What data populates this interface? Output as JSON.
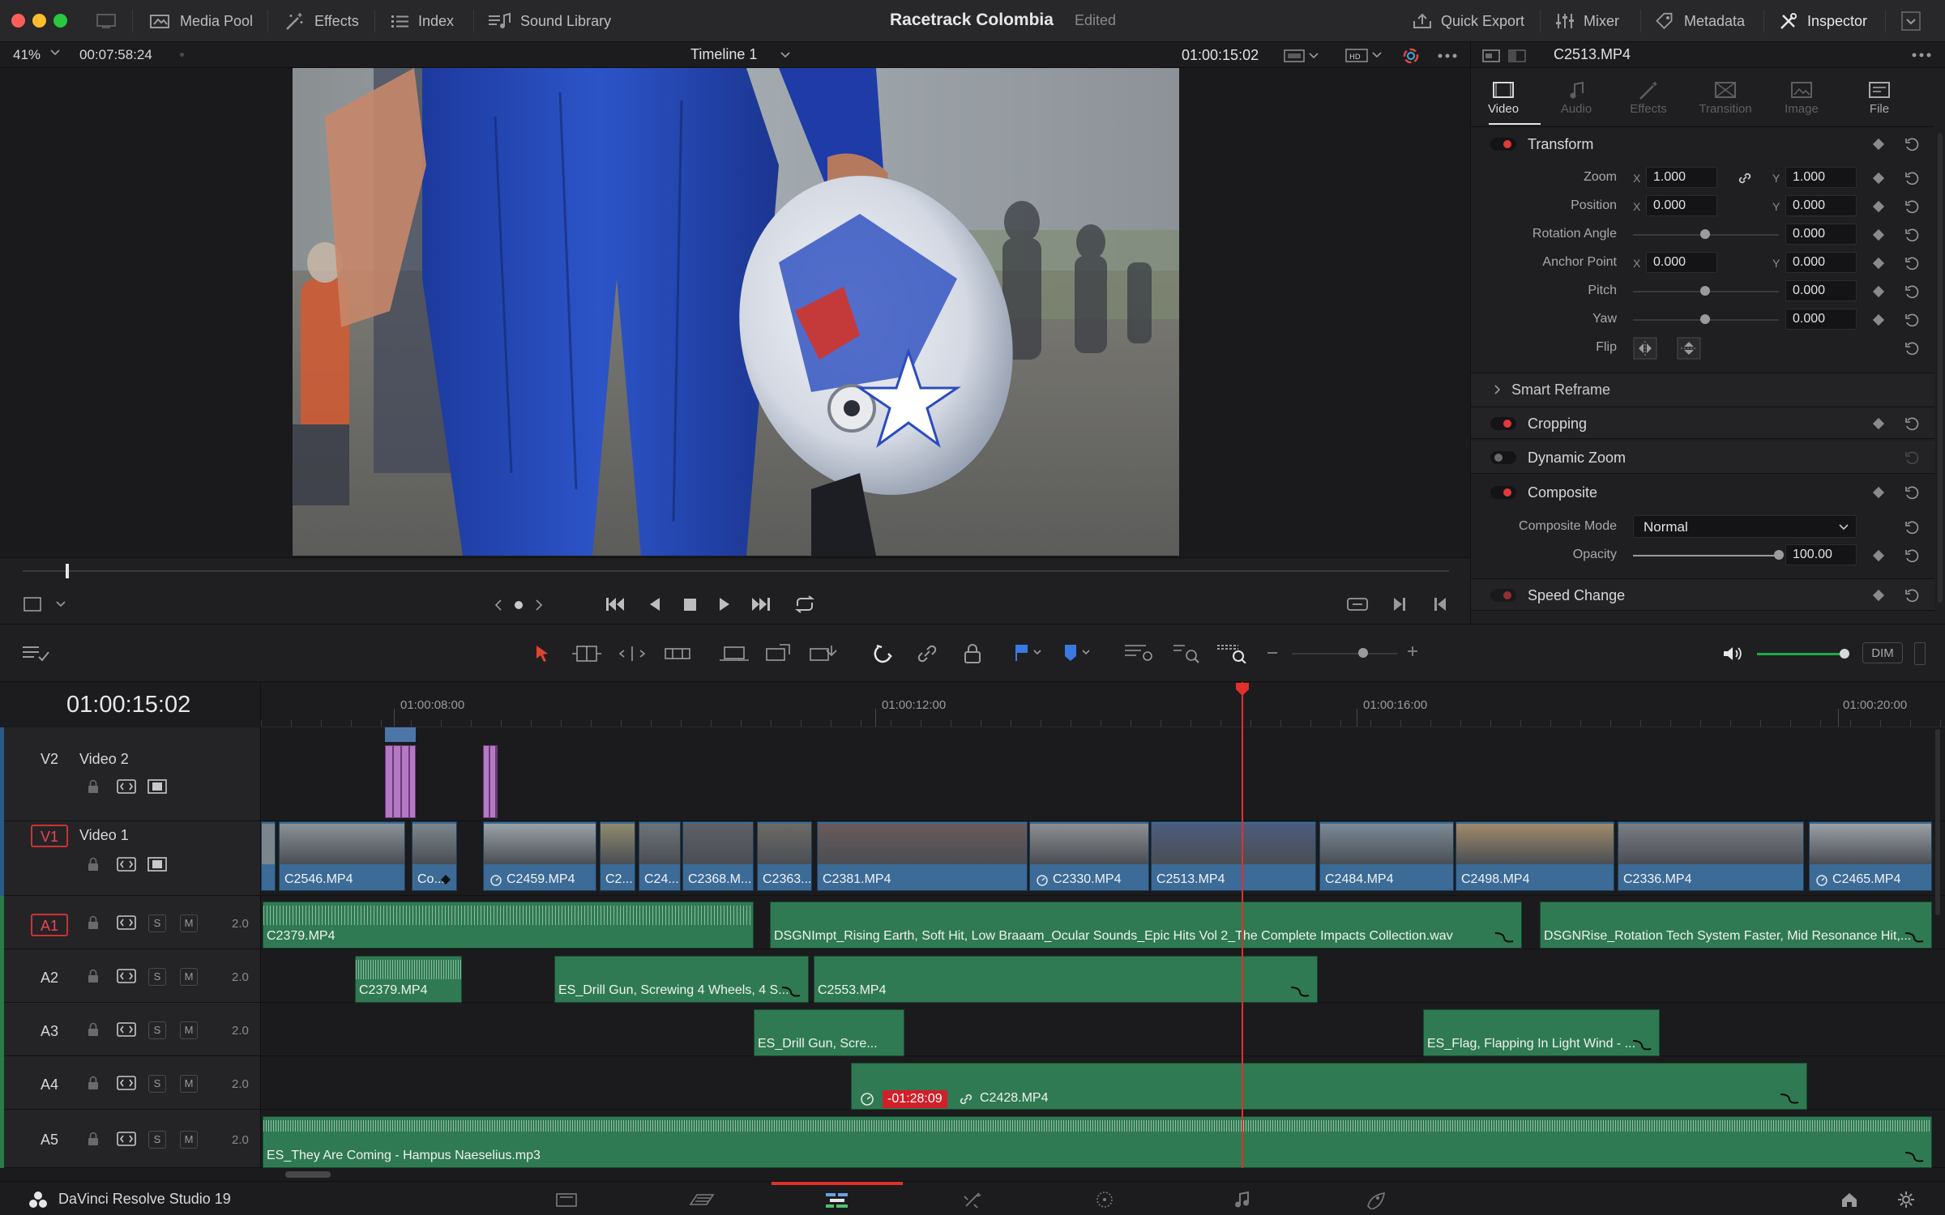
{
  "topbar": {
    "media_pool": "Media Pool",
    "effects": "Effects",
    "index": "Index",
    "sound_library": "Sound Library",
    "project_title": "Racetrack Colombia",
    "project_status": "Edited",
    "quick_export": "Quick Export",
    "mixer": "Mixer",
    "metadata": "Metadata",
    "inspector": "Inspector"
  },
  "viewer": {
    "zoom": "41%",
    "duration": "00:07:58:24",
    "timeline_name": "Timeline 1",
    "timecode": "01:00:15:02",
    "clip_name": "C2513.MP4"
  },
  "inspector": {
    "tabs": [
      "Video",
      "Audio",
      "Effects",
      "Transition",
      "Image",
      "File"
    ],
    "transform": {
      "title": "Transform",
      "zoom_label": "Zoom",
      "zoom_x": "1.000",
      "zoom_y": "1.000",
      "position_label": "Position",
      "position_x": "0.000",
      "position_y": "0.000",
      "rotation_label": "Rotation Angle",
      "rotation": "0.000",
      "anchor_label": "Anchor Point",
      "anchor_x": "0.000",
      "anchor_y": "0.000",
      "pitch_label": "Pitch",
      "pitch": "0.000",
      "yaw_label": "Yaw",
      "yaw": "0.000",
      "flip_label": "Flip",
      "x": "X",
      "y": "Y"
    },
    "smart_reframe": "Smart Reframe",
    "cropping": "Cropping",
    "dynamic_zoom": "Dynamic Zoom",
    "composite": {
      "title": "Composite",
      "mode_label": "Composite Mode",
      "mode_value": "Normal",
      "opacity_label": "Opacity",
      "opacity": "100.00"
    },
    "speed_change": "Speed Change"
  },
  "toolbar": {
    "dim": "DIM"
  },
  "timeline": {
    "timecode": "01:00:15:02",
    "ruler": [
      "01:00:08:00",
      "01:00:12:00",
      "01:00:16:00",
      "01:00:20:00"
    ],
    "tracks": {
      "v2": {
        "id": "V2",
        "name": "Video 2"
      },
      "v1": {
        "id": "V1",
        "name": "Video 1"
      },
      "a1": {
        "id": "A1",
        "ch": "2.0"
      },
      "a2": {
        "id": "A2",
        "ch": "2.0"
      },
      "a3": {
        "id": "A3",
        "ch": "2.0"
      },
      "a4": {
        "id": "A4",
        "ch": "2.0"
      },
      "a5": {
        "id": "A5",
        "ch": "2.0"
      },
      "solo": "S",
      "mute": "M"
    },
    "v1_clips": [
      "C2546.MP4",
      "Co...",
      "C2459.MP4",
      "C2...",
      "C24...",
      "C2368.M...",
      "C2363....",
      "C2381.MP4",
      "C2330.MP4",
      "C2513.MP4",
      "C2484.MP4",
      "C2498.MP4",
      "C2336.MP4",
      "C2465.MP4"
    ],
    "a1_clips": [
      "C2379.MP4",
      "DSGNImpt_Rising Earth, Soft Hit, Low Braaam_Ocular Sounds_Epic Hits Vol 2_The Complete Impacts Collection.wav",
      "DSGNRise_Rotation Tech System Faster, Mid Resonance Hit,..."
    ],
    "a2_clips": [
      "C2379.MP4",
      "ES_Drill Gun, Screwing 4 Wheels, 4 S...",
      "C2553.MP4"
    ],
    "a3_clips": [
      "ES_Drill Gun, Scre...",
      "ES_Flag, Flapping In Light Wind - ..."
    ],
    "a4_clip": {
      "retime": "-01:28:09",
      "name": "C2428.MP4"
    },
    "a5_clip": "ES_They Are Coming - Hampus Naeselius.mp3"
  },
  "bottombar": {
    "app_name": "DaVinci Resolve Studio 19"
  }
}
